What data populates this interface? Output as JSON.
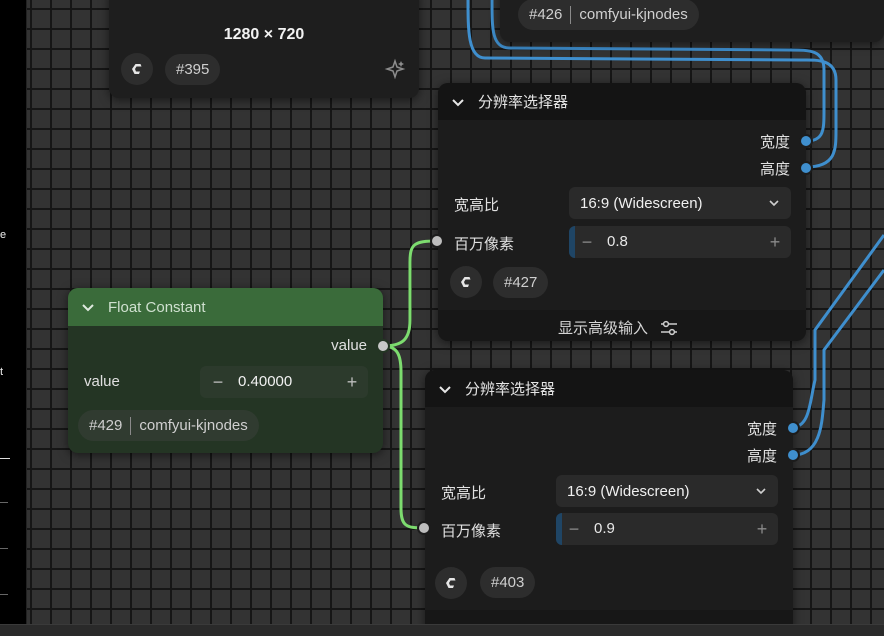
{
  "canvas": {
    "wire_colors": {
      "int": "#3f8fce",
      "float": "#7ddc6f"
    }
  },
  "left_edge": {
    "fragments": [
      "e",
      "t"
    ]
  },
  "node_395": {
    "title": "1280 × 720",
    "badge_id": "#395",
    "sparkle_icon": "sparkle-icon"
  },
  "node_426": {
    "badge_id": "#426",
    "badge_source": "comfyui-kjnodes"
  },
  "node_427": {
    "title": "分辨率选择器",
    "outputs": [
      "宽度",
      "高度"
    ],
    "aspect_label": "宽高比",
    "aspect_value": "16:9 (Widescreen)",
    "mp_label": "百万像素",
    "mp_value": "0.8",
    "badge_id": "#427",
    "advanced_label": "显示高级输入",
    "header_color": "#141414"
  },
  "node_429": {
    "title": "Float Constant",
    "output_label": "value",
    "widget_label": "value",
    "widget_value": "0.40000",
    "badge_id": "#429",
    "badge_source": "comfyui-kjnodes",
    "header_color": "#3a6b3a",
    "body_color": "#243524"
  },
  "node_403": {
    "title": "分辨率选择器",
    "outputs": [
      "宽度",
      "高度"
    ],
    "aspect_label": "宽高比",
    "aspect_value": "16:9 (Widescreen)",
    "mp_label": "百万像素",
    "mp_value": "0.9",
    "badge_id": "#403"
  }
}
